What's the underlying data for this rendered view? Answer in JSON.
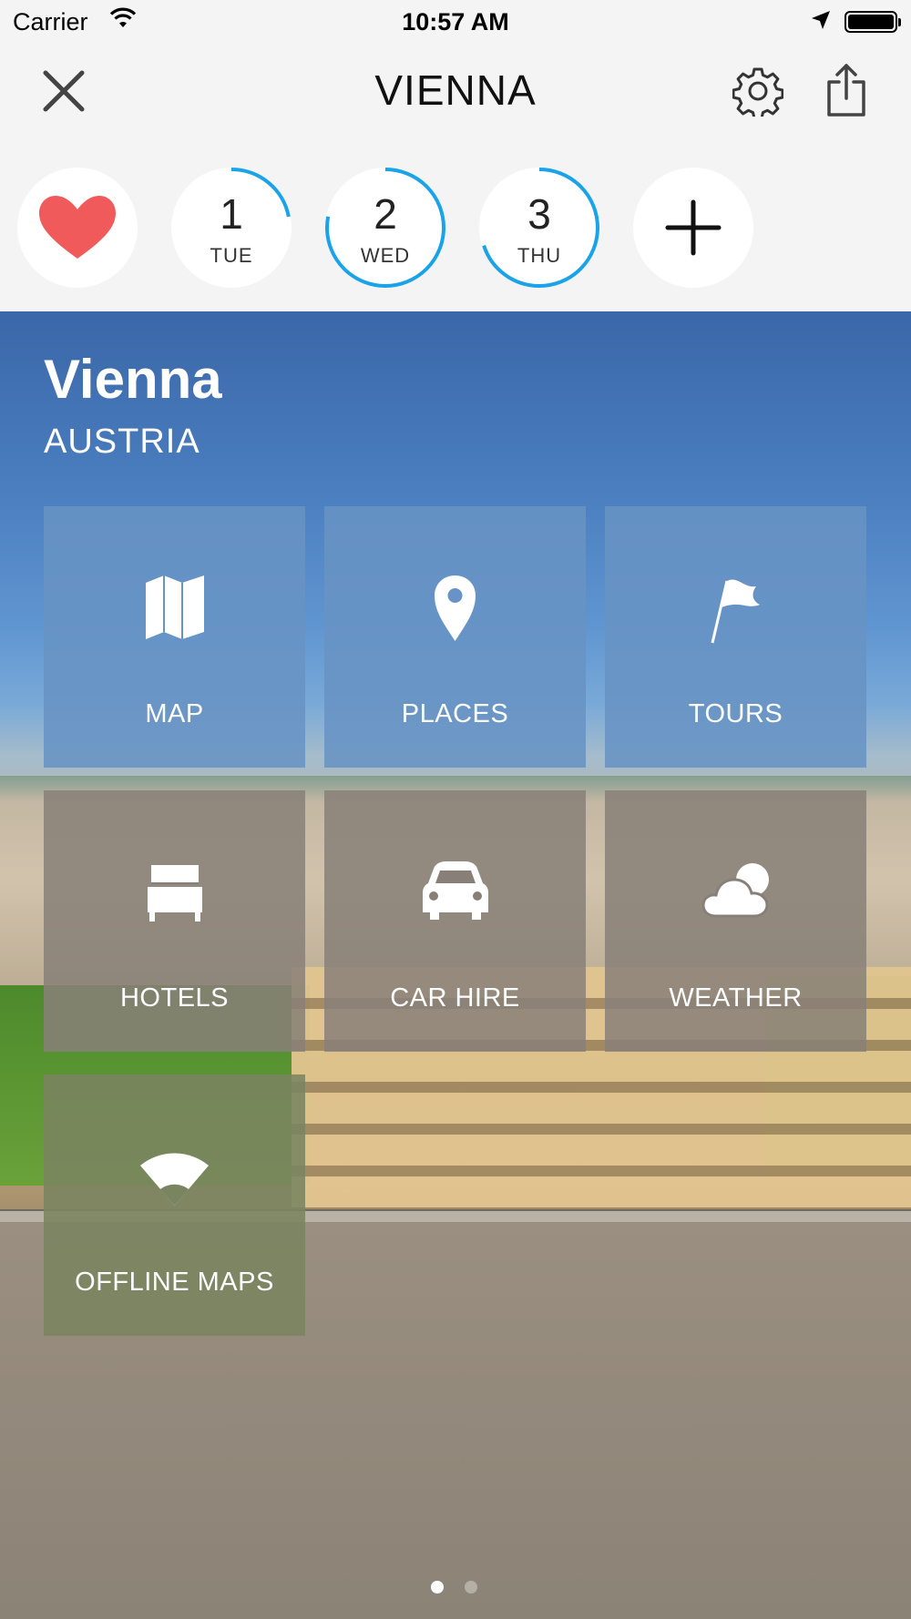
{
  "status_bar": {
    "carrier": "Carrier",
    "time": "10:57 AM"
  },
  "nav": {
    "title": "VIENNA",
    "close_icon": "close-icon",
    "settings_icon": "gear-icon",
    "share_icon": "share-icon"
  },
  "days": [
    {
      "kind": "favorites",
      "icon": "heart-icon",
      "color": "#f05a5b"
    },
    {
      "kind": "day",
      "num": "1",
      "dow": "TUE",
      "progress": 0.22
    },
    {
      "kind": "day",
      "num": "2",
      "dow": "WED",
      "progress": 0.78
    },
    {
      "kind": "day",
      "num": "3",
      "dow": "THU",
      "progress": 0.7
    },
    {
      "kind": "add",
      "icon": "plus-icon"
    }
  ],
  "ring_color": "#1aa3e8",
  "city": {
    "name": "Vienna",
    "country": "AUSTRIA"
  },
  "tiles": [
    {
      "label": "MAP",
      "icon": "map-icon"
    },
    {
      "label": "PLACES",
      "icon": "location-pin-icon"
    },
    {
      "label": "TOURS",
      "icon": "flag-icon"
    },
    {
      "label": "HOTELS",
      "icon": "bed-icon"
    },
    {
      "label": "CAR HIRE",
      "icon": "car-icon"
    },
    {
      "label": "WEATHER",
      "icon": "cloud-sun-icon"
    },
    {
      "label": "OFFLINE MAPS",
      "icon": "wifi-sector-icon"
    }
  ],
  "pager": {
    "pages": 2,
    "current": 1
  }
}
